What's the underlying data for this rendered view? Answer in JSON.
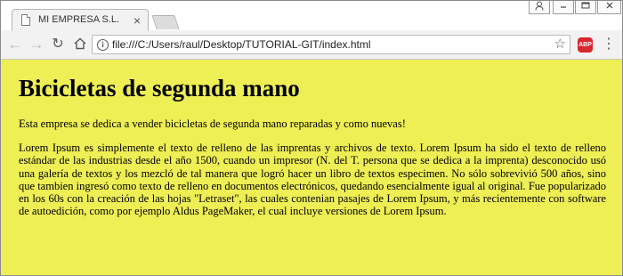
{
  "browser": {
    "tab": {
      "title": "MI EMPRESA S.L.",
      "close_glyph": "×",
      "favicon": "page-icon"
    },
    "window_controls": {
      "user": "user-icon",
      "minimize": "minimize-icon",
      "maximize": "maximize-icon",
      "close": "close-icon"
    },
    "address_bar": {
      "url": "file:///C:/Users/raul/Desktop/TUTORIAL-GIT/index.html"
    },
    "extensions": {
      "abp_label": "ABP"
    }
  },
  "page": {
    "background_color": "#eeee55",
    "heading": "Bicicletas de segunda mano",
    "intro": "Esta empresa se dedica a vender bicicletas de segunda mano reparadas y como nuevas!",
    "body": "Lorem Ipsum es simplemente el texto de relleno de las imprentas y archivos de texto. Lorem Ipsum ha sido el texto de relleno estándar de las industrias desde el año 1500, cuando un impresor (N. del T. persona que se dedica a la imprenta) desconocido usó una galería de textos y los mezcló de tal manera que logró hacer un libro de textos especimen. No sólo sobrevivió 500 años, sino que tambien ingresó como texto de relleno en documentos electrónicos, quedando esencialmente igual al original. Fue popularizado en los 60s con la creación de las hojas \"Letraset\", las cuales contenian pasajes de Lorem Ipsum, y más recientemente con software de autoedición, como por ejemplo Aldus PageMaker, el cual incluye versiones de Lorem Ipsum."
  }
}
